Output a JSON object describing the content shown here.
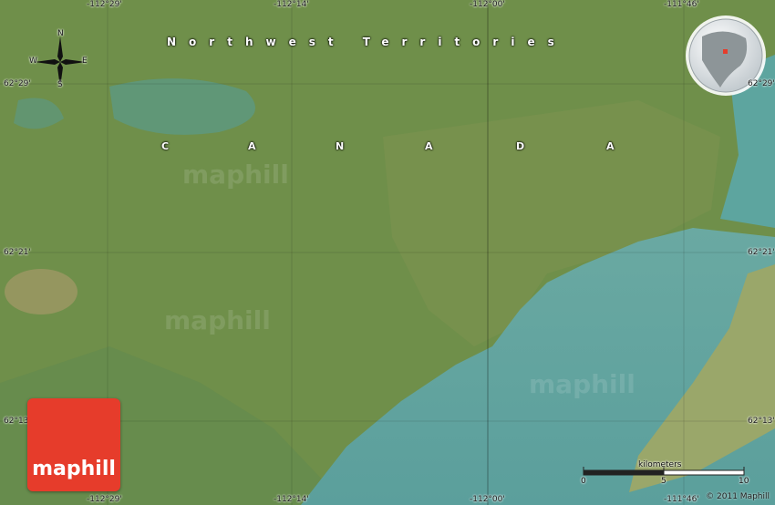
{
  "map": {
    "region_label": "Northwest Territories",
    "country_letters": [
      "C",
      "A",
      "N",
      "A",
      "D",
      "A"
    ],
    "watermark": "maphill",
    "colors": {
      "land": "#6f8f4a",
      "water": "#5fa6a2",
      "logo": "#e63c2b"
    }
  },
  "coordinates": {
    "top": [
      "-112°29'",
      "-112°14'",
      "-112°00'",
      "-111°46'"
    ],
    "bottom": [
      "-112°29'",
      "-112°14'",
      "-112°00'",
      "-111°46'"
    ],
    "left": [
      "62°29'",
      "62°21'",
      "62°13'"
    ],
    "right": [
      "62°29'",
      "62°21'",
      "62°13'"
    ]
  },
  "compass": {
    "n": "N",
    "s": "S",
    "e": "E",
    "w": "W"
  },
  "logo": {
    "text": "maphill"
  },
  "scale": {
    "unit": "kilometers",
    "ticks": [
      "0",
      "5",
      "10"
    ]
  },
  "copyright": "© 2011 Maphill",
  "globe": {
    "icon": "globe-locator-icon"
  }
}
